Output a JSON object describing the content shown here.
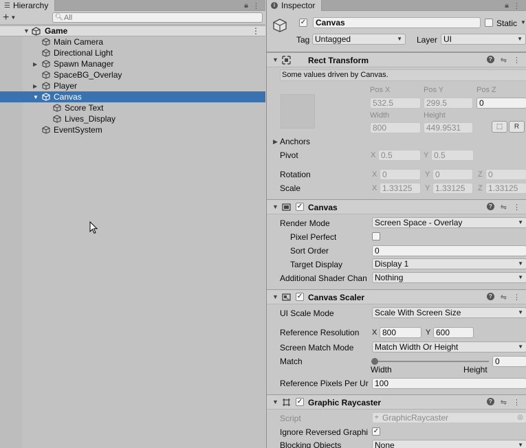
{
  "hierarchy": {
    "tab_label": "Hierarchy",
    "search_placeholder": "All",
    "scene": "Game",
    "items": [
      {
        "label": "Main Camera"
      },
      {
        "label": "Directional Light"
      },
      {
        "label": "Spawn Manager",
        "expandable": true
      },
      {
        "label": "SpaceBG_Overlay"
      },
      {
        "label": "Player",
        "expandable": true
      },
      {
        "label": "Canvas",
        "expanded": true,
        "selected": true
      },
      {
        "label": "Score Text",
        "child": true
      },
      {
        "label": "Lives_Display",
        "child": true
      },
      {
        "label": "EventSystem"
      }
    ]
  },
  "inspector": {
    "tab_label": "Inspector",
    "object": {
      "name": "Canvas",
      "static_label": "Static",
      "tag_label": "Tag",
      "tag_value": "Untagged",
      "layer_label": "Layer",
      "layer_value": "UI"
    },
    "rect_transform": {
      "title": "Rect Transform",
      "note": "Some values driven by Canvas.",
      "pos_x_label": "Pos X",
      "pos_x": "532.5",
      "pos_y_label": "Pos Y",
      "pos_y": "299.5",
      "pos_z_label": "Pos Z",
      "pos_z": "0",
      "width_label": "Width",
      "width": "800",
      "height_label": "Height",
      "height": "449.9531",
      "anchors_label": "Anchors",
      "pivot_label": "Pivot",
      "pivot_x": "0.5",
      "pivot_y": "0.5",
      "rotation_label": "Rotation",
      "rot_x": "0",
      "rot_y": "0",
      "rot_z": "0",
      "scale_label": "Scale",
      "scale_x": "1.33125",
      "scale_y": "1.33125",
      "scale_z": "1.33125",
      "x": "X",
      "y": "Y",
      "z": "Z",
      "r_button": "R"
    },
    "canvas": {
      "title": "Canvas",
      "render_mode_label": "Render Mode",
      "render_mode": "Screen Space - Overlay",
      "pixel_perfect_label": "Pixel Perfect",
      "sort_order_label": "Sort Order",
      "sort_order": "0",
      "target_display_label": "Target Display",
      "target_display": "Display 1",
      "shader_label": "Additional Shader Chan",
      "shader_value": "Nothing"
    },
    "canvas_scaler": {
      "title": "Canvas Scaler",
      "scale_mode_label": "UI Scale Mode",
      "scale_mode": "Scale With Screen Size",
      "ref_res_label": "Reference Resolution",
      "ref_x": "800",
      "ref_y": "600",
      "match_mode_label": "Screen Match Mode",
      "match_mode": "Match Width Or Height",
      "match_label": "Match",
      "match_value": "0",
      "width_end": "Width",
      "height_end": "Height",
      "ref_ppu_label": "Reference Pixels Per Ur",
      "ref_ppu": "100"
    },
    "graphic_raycaster": {
      "title": "Graphic Raycaster",
      "script_label": "Script",
      "script_value": "GraphicRaycaster",
      "ignore_label": "Ignore Reversed Graphi",
      "blocking_label": "Blocking Objects",
      "blocking_value": "None"
    }
  }
}
